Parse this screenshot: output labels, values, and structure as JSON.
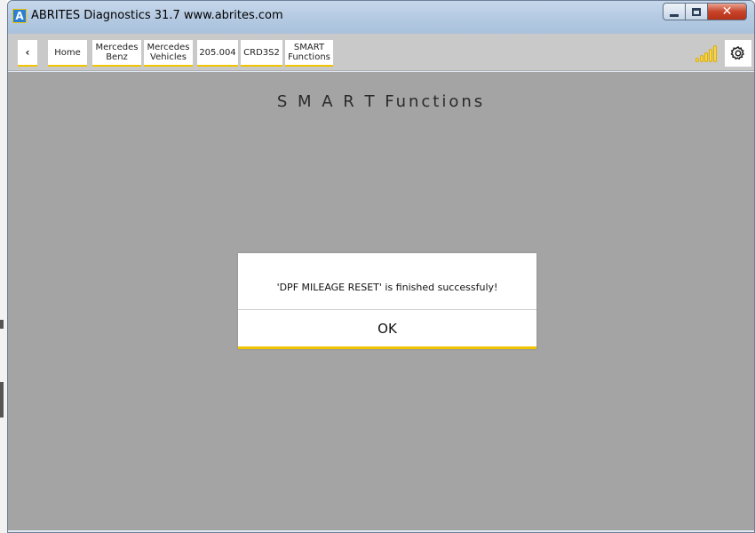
{
  "window": {
    "title": "ABRITES Diagnostics 31.7   www.abrites.com",
    "logo_letter": "A",
    "controls": {
      "close_glyph": "✕"
    }
  },
  "breadcrumbs": [
    {
      "line1": "‹",
      "line2": ""
    },
    {
      "line1": "Home",
      "line2": ""
    },
    {
      "line1": "Mercedes",
      "line2": "Benz"
    },
    {
      "line1": "Mercedes",
      "line2": "Vehicles"
    },
    {
      "line1": "205.004",
      "line2": ""
    },
    {
      "line1": "CRD3S2",
      "line2": ""
    },
    {
      "line1": "SMART",
      "line2": "Functions"
    }
  ],
  "toolbar_icons": {
    "signal": "signal-strength-icon",
    "settings": "gear-icon"
  },
  "page": {
    "title": "S M A R T  Functions"
  },
  "dialog": {
    "message": "'DPF MILEAGE RESET' is finished successfuly!",
    "ok_label": "OK"
  },
  "colors": {
    "accent": "#f0c400",
    "content_bg": "#a4a4a4",
    "navbar_bg": "#c9c9c9"
  }
}
